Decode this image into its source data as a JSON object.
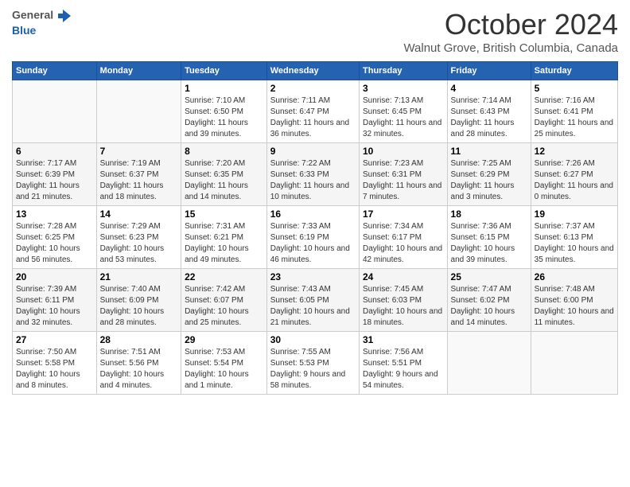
{
  "header": {
    "title": "October 2024",
    "location": "Walnut Grove, British Columbia, Canada",
    "logo_general": "General",
    "logo_blue": "Blue"
  },
  "weekdays": [
    "Sunday",
    "Monday",
    "Tuesday",
    "Wednesday",
    "Thursday",
    "Friday",
    "Saturday"
  ],
  "weeks": [
    [
      {
        "day": "",
        "empty": true
      },
      {
        "day": "",
        "empty": true
      },
      {
        "day": "1",
        "sunrise": "Sunrise: 7:10 AM",
        "sunset": "Sunset: 6:50 PM",
        "daylight": "Daylight: 11 hours and 39 minutes."
      },
      {
        "day": "2",
        "sunrise": "Sunrise: 7:11 AM",
        "sunset": "Sunset: 6:47 PM",
        "daylight": "Daylight: 11 hours and 36 minutes."
      },
      {
        "day": "3",
        "sunrise": "Sunrise: 7:13 AM",
        "sunset": "Sunset: 6:45 PM",
        "daylight": "Daylight: 11 hours and 32 minutes."
      },
      {
        "day": "4",
        "sunrise": "Sunrise: 7:14 AM",
        "sunset": "Sunset: 6:43 PM",
        "daylight": "Daylight: 11 hours and 28 minutes."
      },
      {
        "day": "5",
        "sunrise": "Sunrise: 7:16 AM",
        "sunset": "Sunset: 6:41 PM",
        "daylight": "Daylight: 11 hours and 25 minutes."
      }
    ],
    [
      {
        "day": "6",
        "sunrise": "Sunrise: 7:17 AM",
        "sunset": "Sunset: 6:39 PM",
        "daylight": "Daylight: 11 hours and 21 minutes."
      },
      {
        "day": "7",
        "sunrise": "Sunrise: 7:19 AM",
        "sunset": "Sunset: 6:37 PM",
        "daylight": "Daylight: 11 hours and 18 minutes."
      },
      {
        "day": "8",
        "sunrise": "Sunrise: 7:20 AM",
        "sunset": "Sunset: 6:35 PM",
        "daylight": "Daylight: 11 hours and 14 minutes."
      },
      {
        "day": "9",
        "sunrise": "Sunrise: 7:22 AM",
        "sunset": "Sunset: 6:33 PM",
        "daylight": "Daylight: 11 hours and 10 minutes."
      },
      {
        "day": "10",
        "sunrise": "Sunrise: 7:23 AM",
        "sunset": "Sunset: 6:31 PM",
        "daylight": "Daylight: 11 hours and 7 minutes."
      },
      {
        "day": "11",
        "sunrise": "Sunrise: 7:25 AM",
        "sunset": "Sunset: 6:29 PM",
        "daylight": "Daylight: 11 hours and 3 minutes."
      },
      {
        "day": "12",
        "sunrise": "Sunrise: 7:26 AM",
        "sunset": "Sunset: 6:27 PM",
        "daylight": "Daylight: 11 hours and 0 minutes."
      }
    ],
    [
      {
        "day": "13",
        "sunrise": "Sunrise: 7:28 AM",
        "sunset": "Sunset: 6:25 PM",
        "daylight": "Daylight: 10 hours and 56 minutes."
      },
      {
        "day": "14",
        "sunrise": "Sunrise: 7:29 AM",
        "sunset": "Sunset: 6:23 PM",
        "daylight": "Daylight: 10 hours and 53 minutes."
      },
      {
        "day": "15",
        "sunrise": "Sunrise: 7:31 AM",
        "sunset": "Sunset: 6:21 PM",
        "daylight": "Daylight: 10 hours and 49 minutes."
      },
      {
        "day": "16",
        "sunrise": "Sunrise: 7:33 AM",
        "sunset": "Sunset: 6:19 PM",
        "daylight": "Daylight: 10 hours and 46 minutes."
      },
      {
        "day": "17",
        "sunrise": "Sunrise: 7:34 AM",
        "sunset": "Sunset: 6:17 PM",
        "daylight": "Daylight: 10 hours and 42 minutes."
      },
      {
        "day": "18",
        "sunrise": "Sunrise: 7:36 AM",
        "sunset": "Sunset: 6:15 PM",
        "daylight": "Daylight: 10 hours and 39 minutes."
      },
      {
        "day": "19",
        "sunrise": "Sunrise: 7:37 AM",
        "sunset": "Sunset: 6:13 PM",
        "daylight": "Daylight: 10 hours and 35 minutes."
      }
    ],
    [
      {
        "day": "20",
        "sunrise": "Sunrise: 7:39 AM",
        "sunset": "Sunset: 6:11 PM",
        "daylight": "Daylight: 10 hours and 32 minutes."
      },
      {
        "day": "21",
        "sunrise": "Sunrise: 7:40 AM",
        "sunset": "Sunset: 6:09 PM",
        "daylight": "Daylight: 10 hours and 28 minutes."
      },
      {
        "day": "22",
        "sunrise": "Sunrise: 7:42 AM",
        "sunset": "Sunset: 6:07 PM",
        "daylight": "Daylight: 10 hours and 25 minutes."
      },
      {
        "day": "23",
        "sunrise": "Sunrise: 7:43 AM",
        "sunset": "Sunset: 6:05 PM",
        "daylight": "Daylight: 10 hours and 21 minutes."
      },
      {
        "day": "24",
        "sunrise": "Sunrise: 7:45 AM",
        "sunset": "Sunset: 6:03 PM",
        "daylight": "Daylight: 10 hours and 18 minutes."
      },
      {
        "day": "25",
        "sunrise": "Sunrise: 7:47 AM",
        "sunset": "Sunset: 6:02 PM",
        "daylight": "Daylight: 10 hours and 14 minutes."
      },
      {
        "day": "26",
        "sunrise": "Sunrise: 7:48 AM",
        "sunset": "Sunset: 6:00 PM",
        "daylight": "Daylight: 10 hours and 11 minutes."
      }
    ],
    [
      {
        "day": "27",
        "sunrise": "Sunrise: 7:50 AM",
        "sunset": "Sunset: 5:58 PM",
        "daylight": "Daylight: 10 hours and 8 minutes."
      },
      {
        "day": "28",
        "sunrise": "Sunrise: 7:51 AM",
        "sunset": "Sunset: 5:56 PM",
        "daylight": "Daylight: 10 hours and 4 minutes."
      },
      {
        "day": "29",
        "sunrise": "Sunrise: 7:53 AM",
        "sunset": "Sunset: 5:54 PM",
        "daylight": "Daylight: 10 hours and 1 minute."
      },
      {
        "day": "30",
        "sunrise": "Sunrise: 7:55 AM",
        "sunset": "Sunset: 5:53 PM",
        "daylight": "Daylight: 9 hours and 58 minutes."
      },
      {
        "day": "31",
        "sunrise": "Sunrise: 7:56 AM",
        "sunset": "Sunset: 5:51 PM",
        "daylight": "Daylight: 9 hours and 54 minutes."
      },
      {
        "day": "",
        "empty": true
      },
      {
        "day": "",
        "empty": true
      }
    ]
  ]
}
